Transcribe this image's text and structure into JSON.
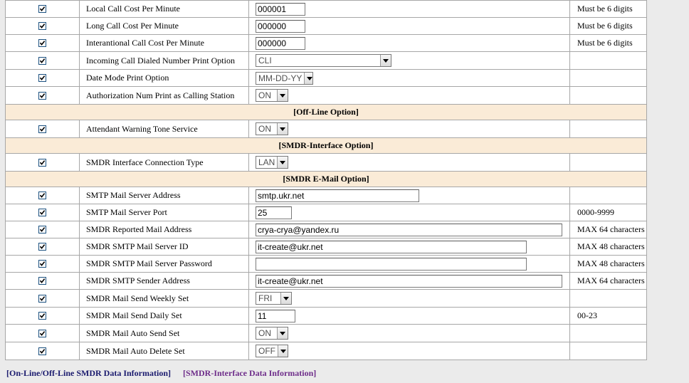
{
  "colors": {
    "section_bg": "#faebd7",
    "link_visited": "#6e2d8a",
    "link": "#1a1a6e"
  },
  "icons": {
    "checkbox": "checkbox-checked-icon",
    "dropdown": "chevron-down-icon"
  },
  "rows": [
    {
      "kind": "row",
      "label": "Local Call Cost Per Minute",
      "control": "text",
      "value": "000001",
      "note": "Must be 6 digits"
    },
    {
      "kind": "row",
      "label": "Long Call Cost Per Minute",
      "control": "text",
      "value": "000000",
      "note": "Must be 6 digits"
    },
    {
      "kind": "row",
      "label": "Interantional Call Cost Per Minute",
      "control": "text",
      "value": "000000",
      "note": "Must be 6 digits"
    },
    {
      "kind": "row",
      "label": "Incoming Call Dialed Number Print Option",
      "control": "select",
      "value": "CLI",
      "note": ""
    },
    {
      "kind": "row",
      "label": "Date Mode Print Option",
      "control": "select",
      "value": "MM-DD-YY",
      "note": ""
    },
    {
      "kind": "row",
      "label": "Authorization Num Print as Calling Station",
      "control": "select",
      "value": "ON",
      "note": ""
    },
    {
      "kind": "section",
      "label": "[Off-Line Option]"
    },
    {
      "kind": "row",
      "label": "Attendant Warning Tone Service",
      "control": "select",
      "value": "ON",
      "note": ""
    },
    {
      "kind": "section",
      "label": "[SMDR-Interface Option]"
    },
    {
      "kind": "row",
      "label": "SMDR Interface Connection Type",
      "control": "select",
      "value": "LAN",
      "note": ""
    },
    {
      "kind": "section",
      "label": "[SMDR E-Mail Option]"
    },
    {
      "kind": "row",
      "label": "SMTP Mail Server Address",
      "control": "text",
      "value": "smtp.ukr.net",
      "note": ""
    },
    {
      "kind": "row",
      "label": "SMTP Mail Server Port",
      "control": "text",
      "value": "25",
      "note": "0000-9999"
    },
    {
      "kind": "row",
      "label": "SMDR Reported Mail Address",
      "control": "text",
      "value": "crya-crya@yandex.ru",
      "note": "MAX 64 characters"
    },
    {
      "kind": "row",
      "label": "SMDR SMTP Mail Server ID",
      "control": "text",
      "value": "it-create@ukr.net",
      "note": "MAX 48 characters"
    },
    {
      "kind": "row",
      "label": "SMDR SMTP Mail Server Password",
      "control": "text",
      "value": "",
      "note": "MAX 48 characters"
    },
    {
      "kind": "row",
      "label": "SMDR SMTP Sender Address",
      "control": "text",
      "value": "it-create@ukr.net",
      "note": "MAX 64 characters"
    },
    {
      "kind": "row",
      "label": "SMDR Mail Send Weekly Set",
      "control": "select",
      "value": "FRI",
      "note": ""
    },
    {
      "kind": "row",
      "label": "SMDR Mail Send Daily Set",
      "control": "text",
      "value": "11",
      "note": "00-23"
    },
    {
      "kind": "row",
      "label": "SMDR Mail Auto Send Set",
      "control": "select",
      "value": "ON",
      "note": ""
    },
    {
      "kind": "row",
      "label": "SMDR Mail Auto Delete Set",
      "control": "select",
      "value": "OFF",
      "note": ""
    }
  ],
  "links": {
    "online_offline": "[On-Line/Off-Line SMDR Data Information]",
    "interface": "[SMDR-Interface Data Information]"
  }
}
